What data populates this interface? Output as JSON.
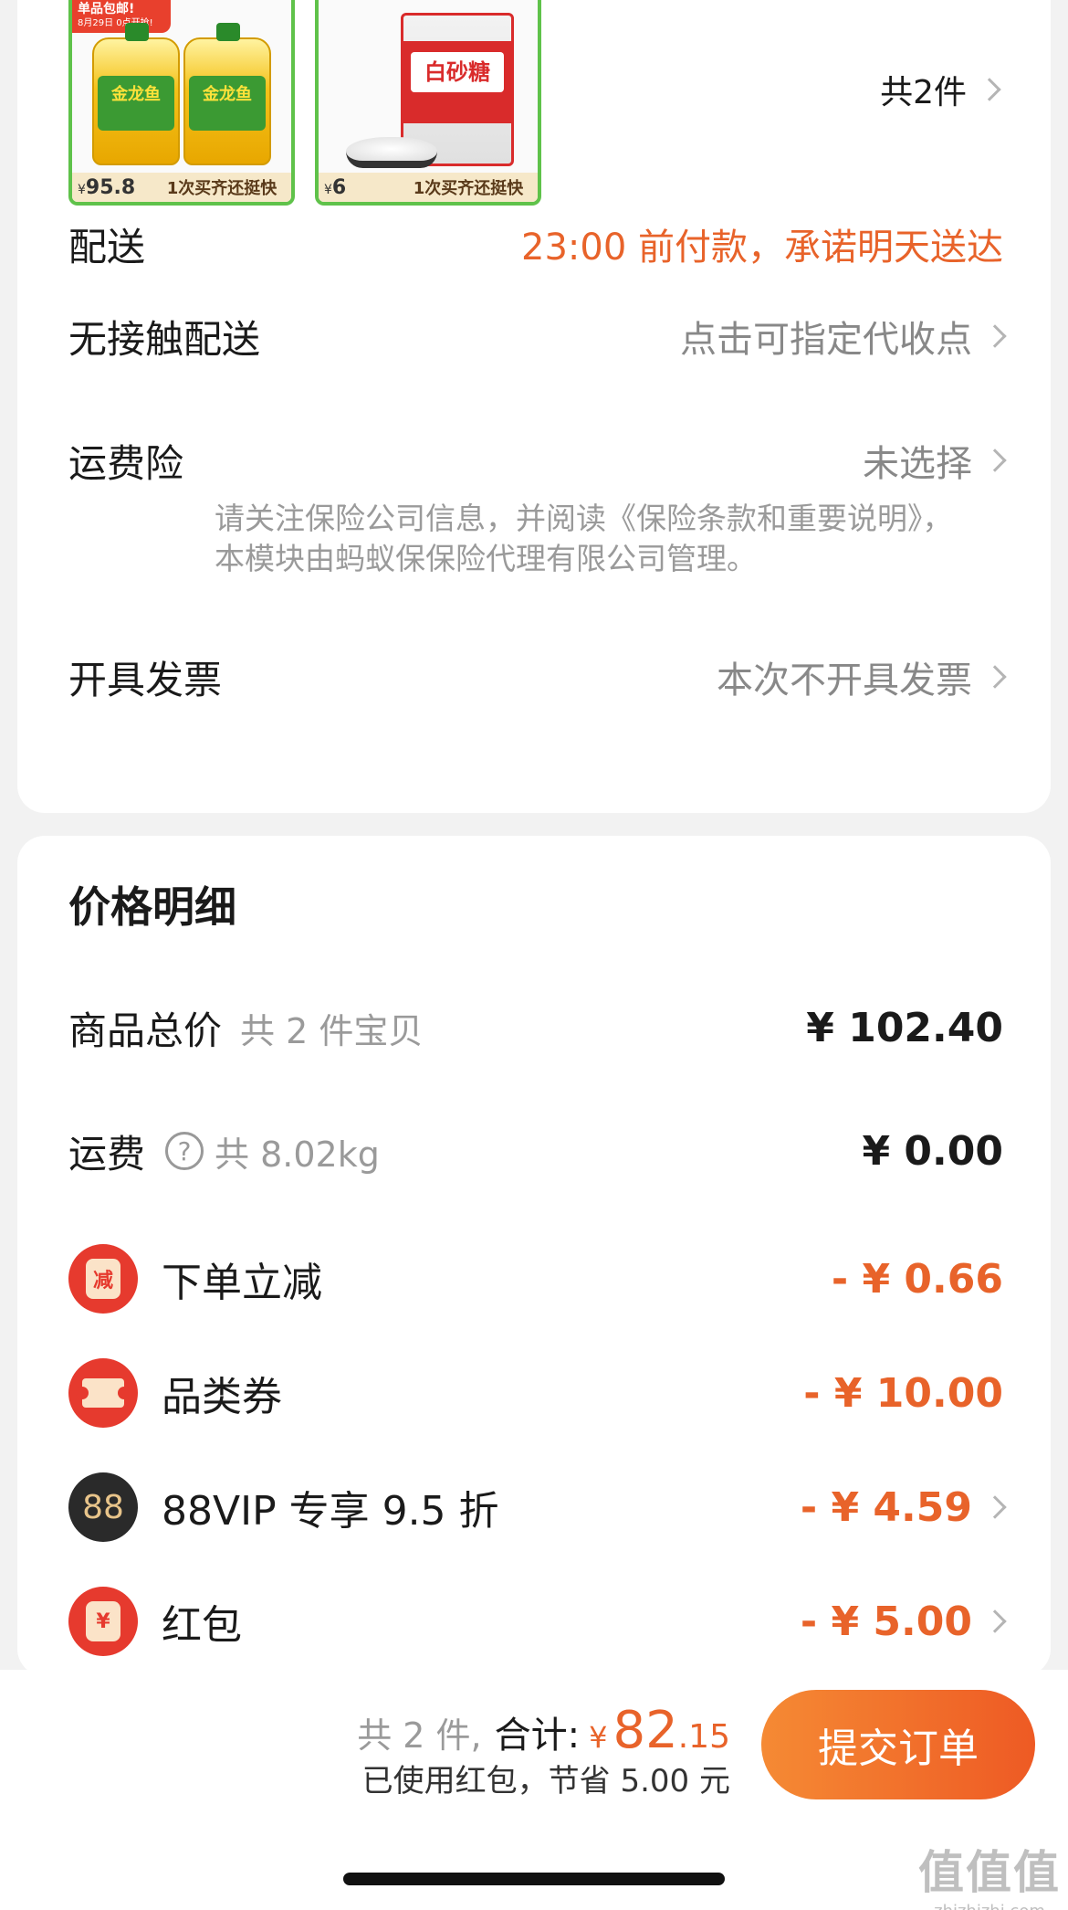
{
  "products": {
    "oil": {
      "badge_title": "单品包邮!",
      "badge_sub": "8月29日 0点开抢!",
      "bottle_label": "金龙鱼",
      "price_symbol": "¥",
      "price": "95.8",
      "slogan": "1次买齐还挺快"
    },
    "sugar": {
      "bag_label": "白砂糖",
      "price_symbol": "¥",
      "price": "6",
      "slogan": "1次买齐还挺快"
    },
    "count_label": "共2件"
  },
  "order_rows": {
    "delivery": {
      "label": "配送",
      "value": "23:00 前付款，承诺明天送达"
    },
    "contactless": {
      "label": "无接触配送",
      "value": "点击可指定代收点"
    },
    "shipping_insurance": {
      "label": "运费险",
      "value": "未选择",
      "note": "请关注保险公司信息，并阅读《保险条款和重要说明》，本模块由蚂蚁保保险代理有限公司管理。"
    },
    "invoice": {
      "label": "开具发票",
      "value": "本次不开具发票"
    }
  },
  "price_detail": {
    "title": "价格明细",
    "goods_total": {
      "label": "商品总价",
      "sub": "共 2 件宝贝",
      "amount": "¥ 102.40"
    },
    "shipping": {
      "label": "运费",
      "sub": "共 8.02kg",
      "amount": "¥ 0.00"
    },
    "discounts": [
      {
        "label": "下单立减",
        "amount": "- ¥ 0.66",
        "icon_text": "减"
      },
      {
        "label": "品类券",
        "amount": "- ¥ 10.00"
      },
      {
        "label": "88VIP 专享 9.5 折",
        "amount": "- ¥ 4.59",
        "icon_text": "88"
      },
      {
        "label": "红包",
        "amount": "- ¥ 5.00",
        "icon_text": "¥"
      }
    ]
  },
  "footer": {
    "count": "共 2 件,",
    "total_label": "合计:",
    "yen": "¥",
    "total_int": "82",
    "total_dec": ".15",
    "saved_text": "已使用红包，节省 5.00 元",
    "submit_label": "提交订单"
  },
  "watermark": {
    "big": "值值值",
    "small": "zhizhizhi.com"
  },
  "colors": {
    "accent": "#e8632a",
    "discount_icon": "#e63a2e",
    "button_start": "#f58a34",
    "button_end": "#ee5a24"
  }
}
